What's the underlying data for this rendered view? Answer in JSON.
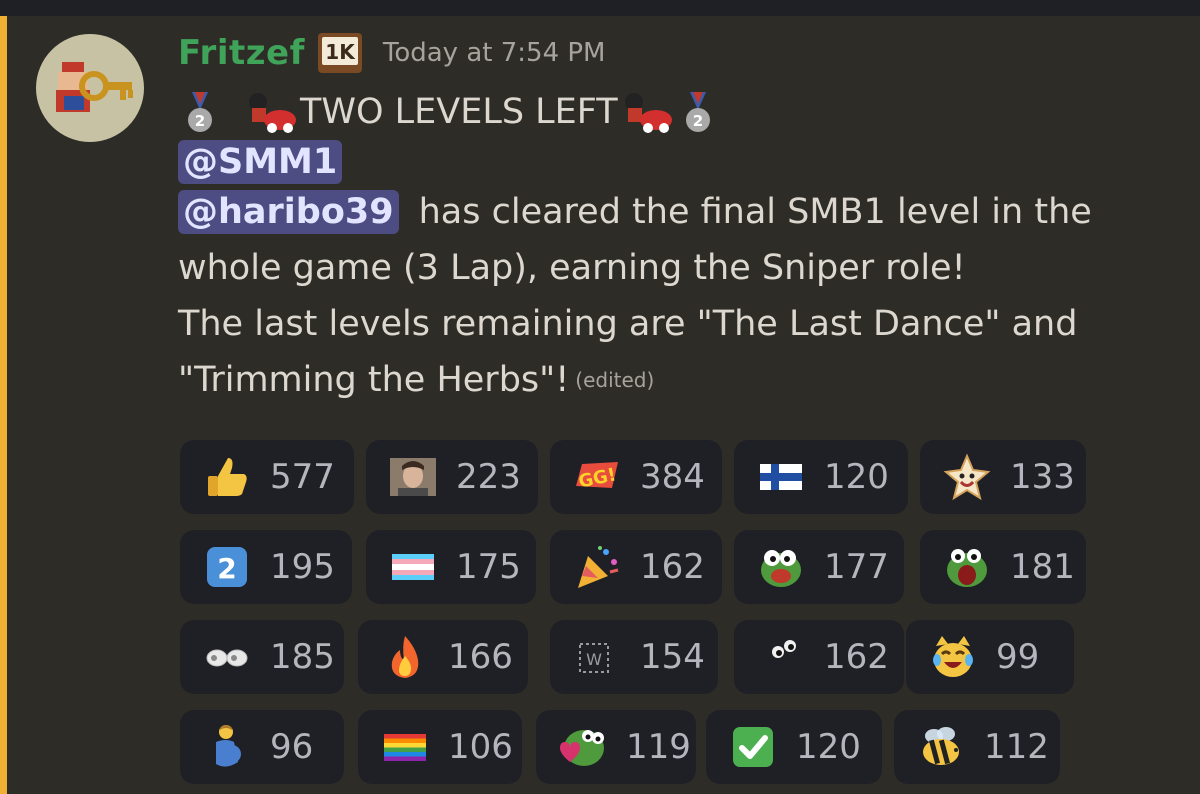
{
  "message": {
    "username": "Fritzef",
    "badge_icon": "1k-badge",
    "timestamp": "Today at 7:54 PM",
    "title_text": "TWO LEVELS LEFT",
    "mention_role": "@SMM1",
    "mention_user": "@haribo39",
    "body_line1_rest": "has cleared the final SMB1 level in the",
    "body_line2": "whole game (3 Lap), earning the Sniper role!",
    "body_line3": "The last levels remaining are \"The Last Dance\" and",
    "body_line4": "\"Trimming the Herbs\"!",
    "edited_label": "(edited)"
  },
  "colors": {
    "accent": "#f0b132",
    "username": "#3fa35a",
    "mention_bg": "#4d4c83",
    "reaction_bg": "#1f2026"
  },
  "reactions": [
    {
      "icon": "thumbs-up",
      "count": "577"
    },
    {
      "icon": "person-photo",
      "count": "223"
    },
    {
      "icon": "gg",
      "count": "384"
    },
    {
      "icon": "finland-flag",
      "count": "120"
    },
    {
      "icon": "star-face",
      "count": "133"
    },
    {
      "icon": "keycap-2",
      "count": "195"
    },
    {
      "icon": "transgender-flag",
      "count": "175"
    },
    {
      "icon": "party-popper",
      "count": "162"
    },
    {
      "icon": "pepe-frog",
      "count": "177"
    },
    {
      "icon": "pepe-frog-shout",
      "count": "181"
    },
    {
      "icon": "googly-eyes",
      "count": "185"
    },
    {
      "icon": "fire",
      "count": "166"
    },
    {
      "icon": "w-placeholder",
      "count": "154"
    },
    {
      "icon": "eyes-small",
      "count": "162"
    },
    {
      "icon": "cat-tears-of-joy",
      "count": "99"
    },
    {
      "icon": "pregnant-man",
      "count": "96"
    },
    {
      "icon": "rainbow-flag",
      "count": "106"
    },
    {
      "icon": "frog-heart",
      "count": "119"
    },
    {
      "icon": "check-mark",
      "count": "120"
    },
    {
      "icon": "bee",
      "count": "112"
    }
  ]
}
